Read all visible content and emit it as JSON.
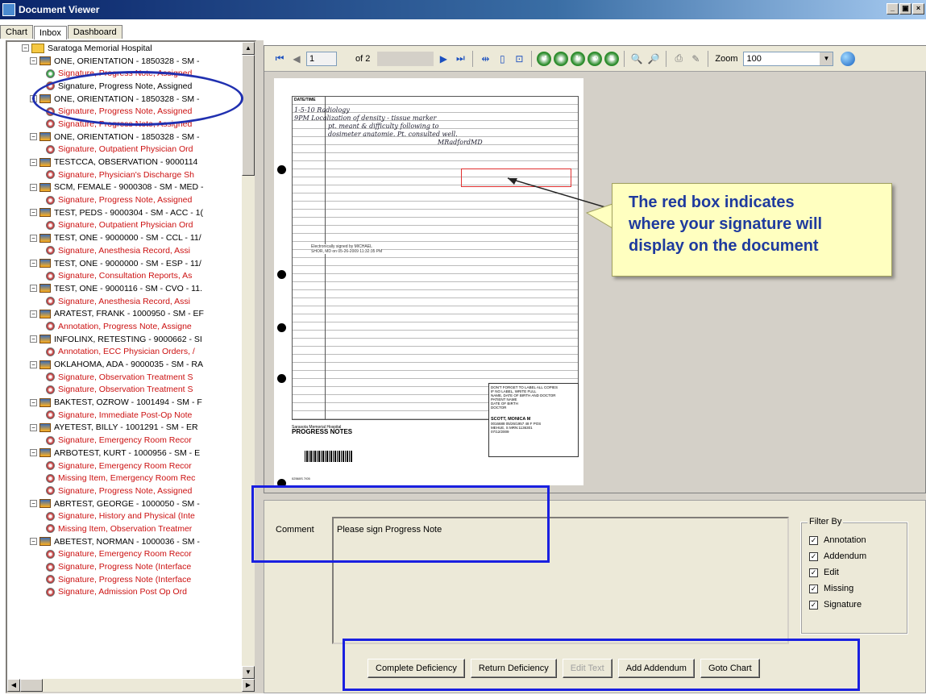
{
  "window": {
    "title": "Document Viewer",
    "min": "_",
    "max": "▣",
    "close": "×"
  },
  "tabs": [
    "Chart",
    "Inbox",
    "Dashboard"
  ],
  "tree": [
    {
      "t": "Saratoga Memorial Hospital",
      "lvl": 0,
      "kind": "root"
    },
    {
      "t": "ONE, ORIENTATION - 1850328 - SM - ",
      "lvl": 1,
      "kind": "parent"
    },
    {
      "t": "Signature, Progress Note, Assigned",
      "lvl": 2,
      "kind": "child-green"
    },
    {
      "t": "Signature, Progress Note, Assigned",
      "lvl": 2,
      "kind": "child-black"
    },
    {
      "t": "ONE, ORIENTATION - 1850328 - SM - ",
      "lvl": 1,
      "kind": "parent"
    },
    {
      "t": "Signature, Progress Note, Assigned",
      "lvl": 2,
      "kind": "child"
    },
    {
      "t": "Signature, Progress Note, Assigned",
      "lvl": 2,
      "kind": "child"
    },
    {
      "t": "ONE, ORIENTATION - 1850328 - SM - ",
      "lvl": 1,
      "kind": "parent"
    },
    {
      "t": "Signature, Outpatient Physician Ord",
      "lvl": 2,
      "kind": "child"
    },
    {
      "t": "TESTCCA, OBSERVATION - 9000114",
      "lvl": 1,
      "kind": "parent"
    },
    {
      "t": "Signature, Physician's Discharge Sh",
      "lvl": 2,
      "kind": "child"
    },
    {
      "t": "SCM, FEMALE - 9000308 - SM - MED -",
      "lvl": 1,
      "kind": "parent"
    },
    {
      "t": "Signature, Progress Note, Assigned",
      "lvl": 2,
      "kind": "child"
    },
    {
      "t": "TEST, PEDS - 9000304 - SM - ACC - 1(",
      "lvl": 1,
      "kind": "parent"
    },
    {
      "t": "Signature, Outpatient Physician Ord",
      "lvl": 2,
      "kind": "child"
    },
    {
      "t": "TEST, ONE - 9000000 - SM - CCL - 11/",
      "lvl": 1,
      "kind": "parent"
    },
    {
      "t": "Signature, Anesthesia Record, Assi",
      "lvl": 2,
      "kind": "child"
    },
    {
      "t": "TEST, ONE - 9000000 - SM - ESP - 11/",
      "lvl": 1,
      "kind": "parent"
    },
    {
      "t": "Signature, Consultation Reports, As",
      "lvl": 2,
      "kind": "child"
    },
    {
      "t": "TEST, ONE - 9000116 - SM - CVO - 11.",
      "lvl": 1,
      "kind": "parent"
    },
    {
      "t": "Signature, Anesthesia Record, Assi",
      "lvl": 2,
      "kind": "child"
    },
    {
      "t": "ARATEST, FRANK - 1000950 - SM - EF",
      "lvl": 1,
      "kind": "parent"
    },
    {
      "t": "Annotation, Progress Note, Assigne",
      "lvl": 2,
      "kind": "child"
    },
    {
      "t": "INFOLINX, RETESTING - 9000662 - SI",
      "lvl": 1,
      "kind": "parent"
    },
    {
      "t": "Annotation, ECC Physician Orders, /",
      "lvl": 2,
      "kind": "child"
    },
    {
      "t": "OKLAHOMA, ADA - 9000035 - SM - RA",
      "lvl": 1,
      "kind": "parent"
    },
    {
      "t": "Signature, Observation Treatment S",
      "lvl": 2,
      "kind": "child"
    },
    {
      "t": "Signature, Observation Treatment S",
      "lvl": 2,
      "kind": "child"
    },
    {
      "t": "BAKTEST, OZROW - 1001494 - SM - F",
      "lvl": 1,
      "kind": "parent"
    },
    {
      "t": "Signature, Immediate Post-Op Note",
      "lvl": 2,
      "kind": "child"
    },
    {
      "t": "AYETEST, BILLY - 1001291 - SM - ER",
      "lvl": 1,
      "kind": "parent"
    },
    {
      "t": "Signature, Emergency Room Recor",
      "lvl": 2,
      "kind": "child"
    },
    {
      "t": "ARBOTEST, KURT - 1000956 - SM - E",
      "lvl": 1,
      "kind": "parent"
    },
    {
      "t": "Signature, Emergency Room Recor",
      "lvl": 2,
      "kind": "child"
    },
    {
      "t": "Missing Item, Emergency Room Rec",
      "lvl": 2,
      "kind": "child"
    },
    {
      "t": "Signature, Progress Note, Assigned",
      "lvl": 2,
      "kind": "child"
    },
    {
      "t": "ABRTEST, GEORGE - 1000050 - SM -",
      "lvl": 1,
      "kind": "parent"
    },
    {
      "t": "Signature, History and Physical (Inte",
      "lvl": 2,
      "kind": "child"
    },
    {
      "t": "Missing Item, Observation Treatmer",
      "lvl": 2,
      "kind": "child"
    },
    {
      "t": "ABETEST, NORMAN - 1000036 - SM -",
      "lvl": 1,
      "kind": "parent"
    },
    {
      "t": "Signature, Emergency Room Recor",
      "lvl": 2,
      "kind": "child"
    },
    {
      "t": "Signature, Progress Note (Interface",
      "lvl": 2,
      "kind": "child"
    },
    {
      "t": "Signature, Progress Note (Interface",
      "lvl": 2,
      "kind": "child"
    },
    {
      "t": "Signature, Admission Post Op Ord",
      "lvl": 2,
      "kind": "child"
    }
  ],
  "toolbar": {
    "page_value": "1",
    "of_label": "of 2",
    "zoom_label": "Zoom",
    "zoom_value": "100"
  },
  "document": {
    "header_label": "DATE/TIME",
    "hw_lines": [
      "1-5-10  Radiology",
      "9PM    Localization of density - tissue marker",
      "pt. meant & difficulty following to",
      "dosimeter anatomie. Pt. consulted well.",
      "                              MRadfordMD"
    ],
    "esig": [
      "Electronically signed by MICHAEL",
      "SHOR, MD on 05-26-2009 11:32:35 PM"
    ],
    "stamp_lines": [
      "DON'T FORGET TO LABEL ALL COPIES",
      "IF NO LABEL, WRITE FULL",
      "NAME, DATE OF BIRTH AND DOCTOR",
      "PATIENT NAME",
      "DATE OF BIRTH",
      "DOCTOR"
    ],
    "stamp_patient": [
      "SCOTT, MONICA M",
      "0016688 05/26/1957 48 F POS",
      "MEHUE, S  MRN:1136301",
      "07/12/2009"
    ],
    "hospital": "Sarasota Memorial Hospital",
    "hospital_dept": "PROGRESS NOTES",
    "form_no": "02560S 7/05"
  },
  "callout_text": "The red box indicates\nwhere your signature will\ndisplay on the document",
  "comment": {
    "label": "Comment",
    "value": "Please sign Progress Note"
  },
  "filter": {
    "title": "Filter By",
    "items": [
      "Annotation",
      "Addendum",
      "Edit",
      "Missing",
      "Signature"
    ],
    "check": "✓"
  },
  "buttons": {
    "complete": "Complete Deficiency",
    "return": "Return Deficiency",
    "edit": "Edit Text",
    "addendum": "Add Addendum",
    "goto": "Goto Chart"
  },
  "colors": {
    "highlight": "#1a20e0",
    "red_box": "#e03030",
    "callout_text": "#1e3a9e",
    "child_text": "#cc1111"
  }
}
